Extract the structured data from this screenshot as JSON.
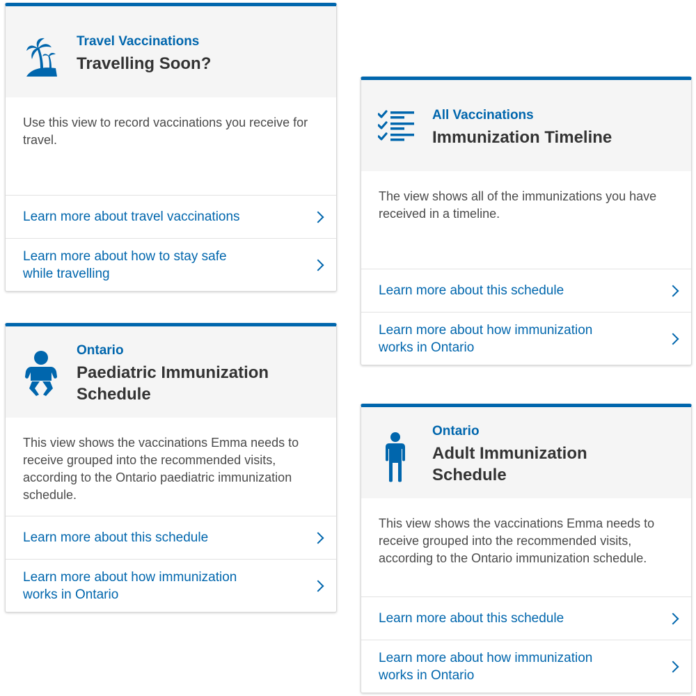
{
  "cards": [
    {
      "icon": "palm-tree-island-icon",
      "eyebrow": "Travel Vaccinations",
      "title": "Travelling Soon?",
      "description": "Use this view to record vaccinations you receive for travel.",
      "links": [
        {
          "label": "Learn more about travel vaccinations"
        },
        {
          "label": "Learn more about how to stay safe while travelling"
        }
      ]
    },
    {
      "icon": "checklist-icon",
      "eyebrow": "All Vaccinations",
      "title": "Immunization Timeline",
      "description": "The view shows all of the immunizations you have received in a timeline.",
      "links": [
        {
          "label": "Learn more about this schedule"
        },
        {
          "label": "Learn more about how immunization works in Ontario"
        }
      ]
    },
    {
      "icon": "baby-icon",
      "eyebrow": "Ontario",
      "title": "Paediatric Immunization Schedule",
      "description": "This view shows the vaccinations Emma needs to receive grouped into the recommended visits, according to the Ontario paediatric immunization schedule.",
      "links": [
        {
          "label": "Learn more about this schedule"
        },
        {
          "label": "Learn more about how immunization works in Ontario"
        }
      ]
    },
    {
      "icon": "adult-person-icon",
      "eyebrow": "Ontario",
      "title": "Adult Immunization Schedule",
      "description": "This view shows the vaccinations Emma needs to receive grouped into the recommended visits, according to the Ontario immunization schedule.",
      "links": [
        {
          "label": "Learn more about this schedule"
        },
        {
          "label": "Learn more about how immunization works in Ontario"
        }
      ]
    }
  ],
  "colors": {
    "accent": "#0066ad",
    "header_bg": "#f5f5f5",
    "title_text": "#333333",
    "body_text": "#4a4a4a"
  }
}
